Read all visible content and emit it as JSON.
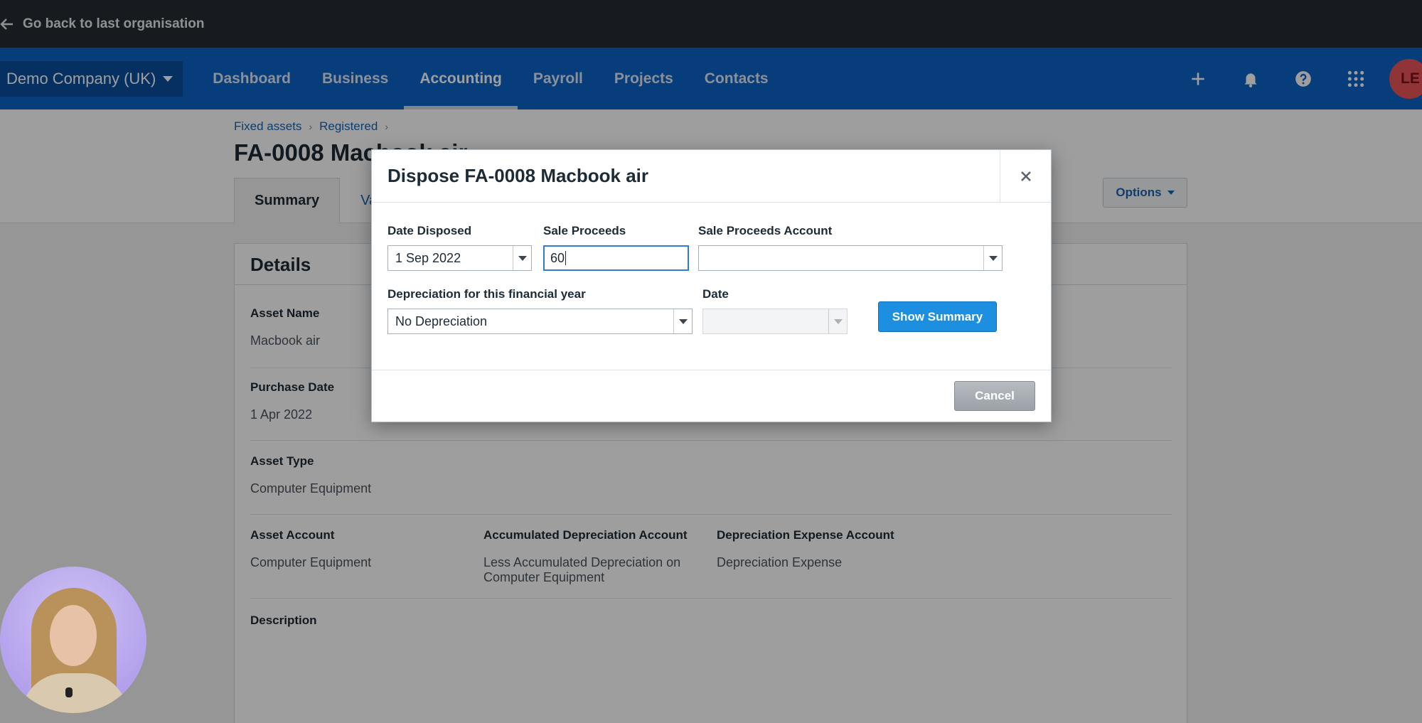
{
  "topbar": {
    "back_label": "Go back to last organisation"
  },
  "nav": {
    "org_name": "Demo Company (UK)",
    "items": [
      {
        "label": "Dashboard"
      },
      {
        "label": "Business"
      },
      {
        "label": "Accounting",
        "active": true
      },
      {
        "label": "Payroll"
      },
      {
        "label": "Projects"
      },
      {
        "label": "Contacts"
      }
    ],
    "avatar_initials": "LE"
  },
  "page": {
    "breadcrumb": [
      "Fixed assets",
      "Registered"
    ],
    "title": "FA-0008 Macbook air",
    "tabs": [
      "Summary",
      "Va"
    ],
    "options_label": "Options"
  },
  "details": {
    "heading": "Details",
    "asset_name_label": "Asset Name",
    "asset_name_value": "Macbook air",
    "purchase_date_label": "Purchase Date",
    "purchase_date_value": "1 Apr 2022",
    "asset_type_label": "Asset Type",
    "asset_type_value": "Computer Equipment",
    "asset_account_label": "Asset Account",
    "asset_account_value": "Computer Equipment",
    "accum_dep_label": "Accumulated Depreciation Account",
    "accum_dep_value": "Less Accumulated Depreciation on Computer Equipment",
    "dep_expense_label": "Depreciation Expense Account",
    "dep_expense_value": "Depreciation Expense",
    "description_label": "Description"
  },
  "modal": {
    "title": "Dispose FA-0008 Macbook air",
    "date_disposed_label": "Date Disposed",
    "date_disposed_value": "1 Sep 2022",
    "sale_proceeds_label": "Sale Proceeds",
    "sale_proceeds_value": "60",
    "sale_account_label": "Sale Proceeds Account",
    "sale_account_value": "",
    "depreciation_label": "Depreciation for this financial year",
    "depreciation_value": "No Depreciation",
    "date_label": "Date",
    "date_value": "",
    "show_summary_label": "Show Summary",
    "cancel_label": "Cancel"
  },
  "colors": {
    "topbar": "#262b33",
    "navbar": "#0d63c7",
    "primary_button": "#1c8fe0",
    "avatar": "#e8545a"
  },
  "icons": [
    "arrow-left-icon",
    "chevron-down-icon",
    "plus-icon",
    "bell-icon",
    "help-icon",
    "app-grid-icon",
    "close-icon"
  ]
}
